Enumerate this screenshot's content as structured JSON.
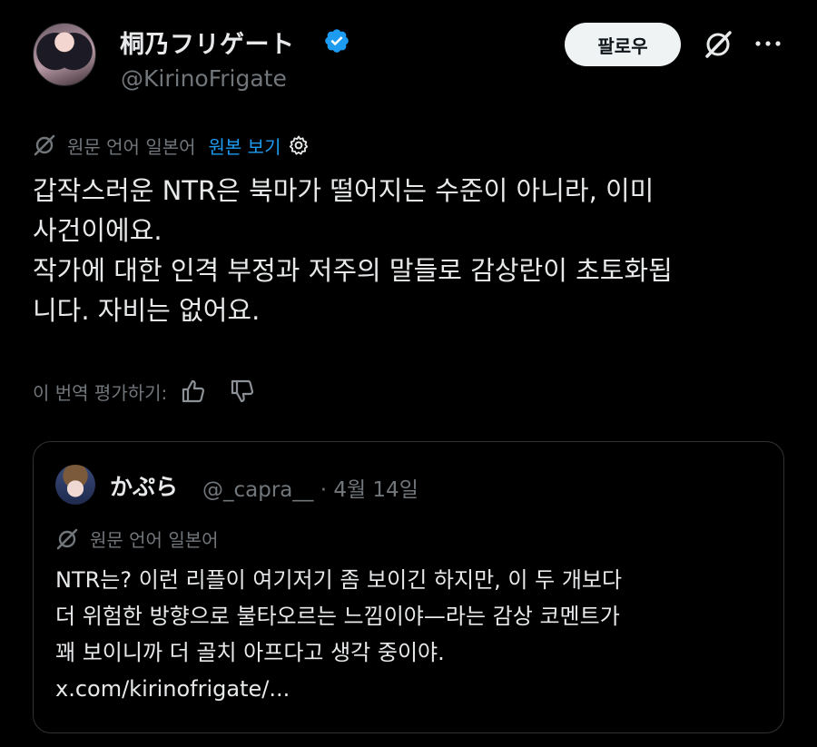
{
  "author": {
    "display_name": "桐乃フリゲート",
    "handle": "@KirinoFrigate",
    "verified": true
  },
  "actions": {
    "follow_label": "팔로우",
    "grok_icon": "grok-icon",
    "more_icon": "more-dots-icon"
  },
  "translation": {
    "label": "원문 언어 일본어",
    "show_original": "원본 보기"
  },
  "tweet": {
    "lines": [
      "갑작스러운 NTR은 북마가 떨어지는 수준이 아니라, 이미",
      "사건이에요.",
      "작가에 대한 인격 부정과 저주의 말들로 감상란이 초토화됩",
      "니다. 자비는 없어요."
    ]
  },
  "rating": {
    "label": "이 번역 평가하기:"
  },
  "quote": {
    "display_name": "かぷら",
    "handle_date": "@_capra__ · 4월 14일",
    "translation_label": "원문 언어 일본어",
    "lines": [
      "NTR는? 이런 리플이 여기저기 좀 보이긴 하지만, 이 두 개보다",
      "더 위험한 방향으로 불타오르는 느낌이야—라는 감상 코멘트가",
      "꽤 보이니까 더 골치 아프다고 생각 중이야.",
      "x.com/kirinofrigate/..."
    ]
  },
  "colors": {
    "background": "#000000",
    "text": "#e7e9ea",
    "muted": "#71767b",
    "link": "#1d9bf0",
    "verified": "#1d9bf0",
    "border": "#2f3336"
  }
}
